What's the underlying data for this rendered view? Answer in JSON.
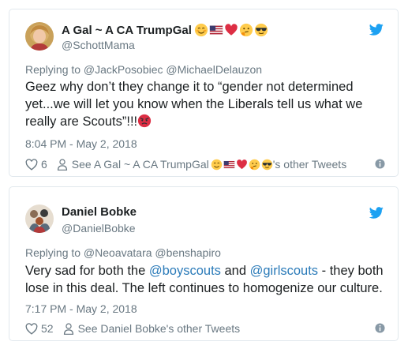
{
  "tweets": [
    {
      "display_name": "A Gal ~ A CA TrumpGal",
      "name_emojis": [
        "smiling-face-icon",
        "us-flag-icon",
        "red-heart-icon",
        "thinking-face-icon",
        "sunglasses-face-icon"
      ],
      "handle": "@SchottMama",
      "replying_to": "Replying to @JackPosobiec @MichaelDelauzon",
      "body_text": "Geez why don’t they change it to “gender not determined yet...we will let you know when the Liberals tell us what we really are Scouts”!!!",
      "body_emoji": "angry-face-icon",
      "timestamp": "8:04 PM - May 2, 2018",
      "like_count": "6",
      "see_other_prefix": "See A Gal ~ A CA TrumpGal",
      "see_other_suffix": "'s other Tweets"
    },
    {
      "display_name": "Daniel Bobke",
      "handle": "@DanielBobke",
      "replying_to": "Replying to @Neoavatara @benshapiro",
      "body_part1": "Very sad for both the ",
      "body_link1": "@boyscouts",
      "body_part2": " and ",
      "body_link2": "@girlscouts",
      "body_part3": " - they both lose in this deal. The left continues to homogenize our culture.",
      "timestamp": "7:17 PM - May 2, 2018",
      "like_count": "52",
      "see_other": "See Daniel Bobke's other Tweets"
    }
  ],
  "colors": {
    "text": "#1c2022",
    "secondary": "#697882",
    "link": "#2b7bb9",
    "twitter_blue": "#1da1f2",
    "border": "#e1e8ed"
  }
}
